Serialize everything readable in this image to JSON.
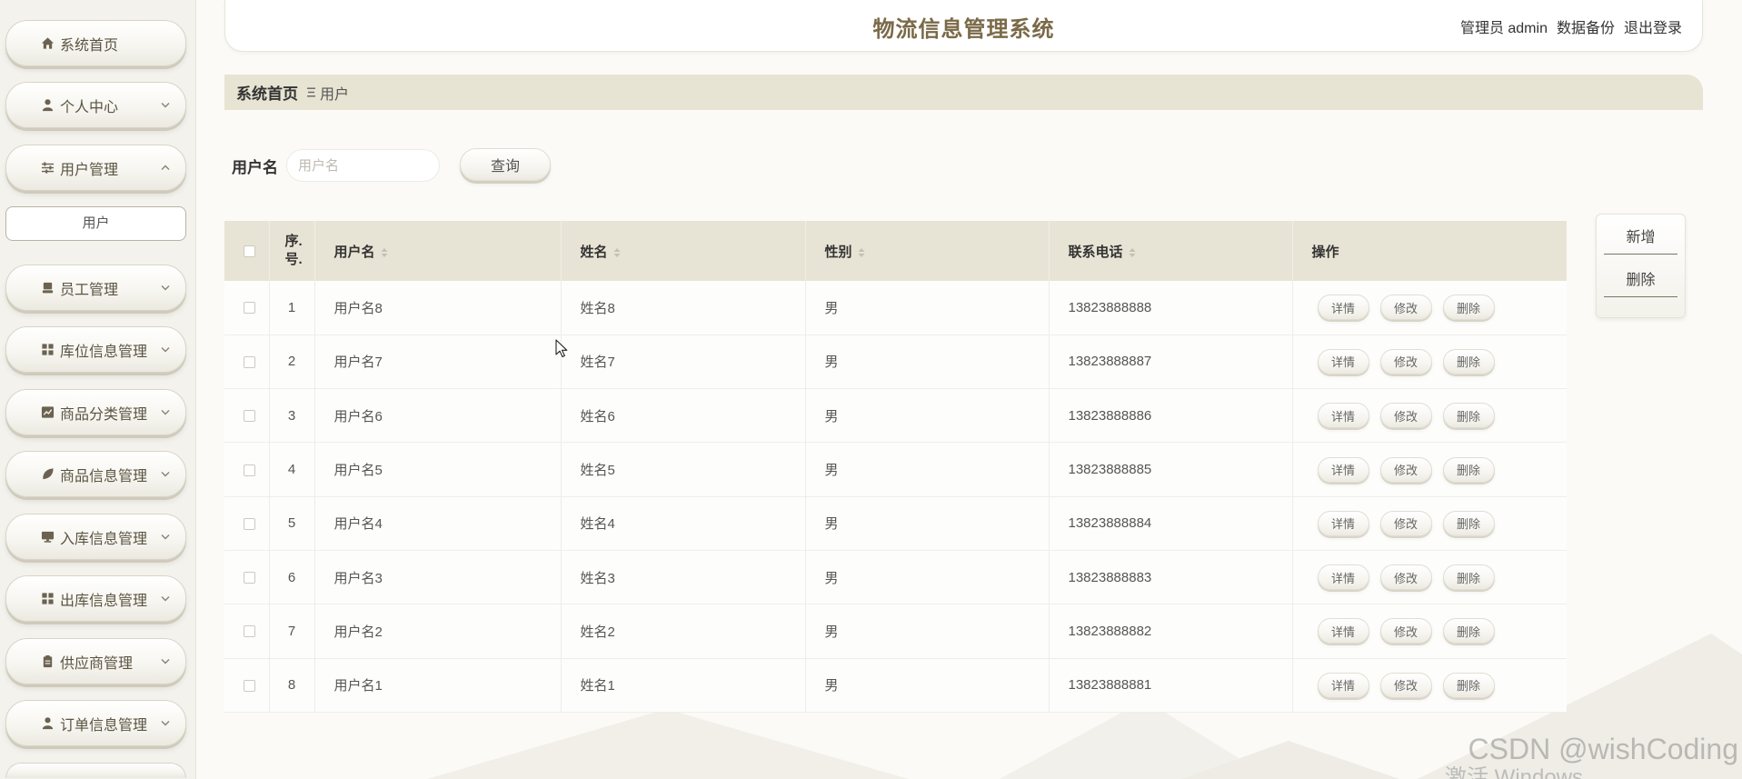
{
  "header": {
    "title": "物流信息管理系统",
    "user_label": "管理员 admin",
    "backup_label": "数据备份",
    "logout_label": "退出登录"
  },
  "sidebar": {
    "items": [
      {
        "label": "系统首页",
        "icon": "home-icon"
      },
      {
        "label": "个人中心",
        "icon": "person-icon",
        "chevron": "chevron-down-icon"
      },
      {
        "label": "用户管理",
        "icon": "sliders-icon",
        "chevron": "chevron-up-icon",
        "expanded": true
      },
      {
        "label": "员工管理",
        "icon": "archive-icon",
        "chevron": "chevron-down-icon"
      },
      {
        "label": "库位信息管理",
        "icon": "grid-icon",
        "chevron": "chevron-down-icon"
      },
      {
        "label": "商品分类管理",
        "icon": "chart-icon",
        "chevron": "chevron-down-icon"
      },
      {
        "label": "商品信息管理",
        "icon": "leaf-icon",
        "chevron": "chevron-down-icon"
      },
      {
        "label": "入库信息管理",
        "icon": "monitor-icon",
        "chevron": "chevron-down-icon"
      },
      {
        "label": "出库信息管理",
        "icon": "grid-icon",
        "chevron": "chevron-down-icon"
      },
      {
        "label": "供应商管理",
        "icon": "clipboard-icon",
        "chevron": "chevron-down-icon"
      },
      {
        "label": "订单信息管理",
        "icon": "person-icon",
        "chevron": "chevron-down-icon"
      }
    ],
    "submenu": [
      {
        "label": "用户",
        "active": true
      }
    ]
  },
  "breadcrumb": {
    "home": "系统首页",
    "separator_icon": "menu-lines-icon",
    "current": "用户"
  },
  "search": {
    "label": "用户名",
    "placeholder": "用户名",
    "value": "",
    "button_label": "查询"
  },
  "toolbar": {
    "add_label": "新增",
    "delete_label": "删除"
  },
  "table": {
    "seq_header": [
      "序.",
      "号."
    ],
    "headers": {
      "username": "用户名",
      "name": "姓名",
      "gender": "性别",
      "phone": "联系电话",
      "actions": "操作"
    },
    "row_actions": {
      "detail": "详情",
      "edit": "修改",
      "delete": "删除"
    },
    "rows": [
      {
        "seq": 1,
        "username": "用户名8",
        "name": "姓名8",
        "gender": "男",
        "phone": "13823888888"
      },
      {
        "seq": 2,
        "username": "用户名7",
        "name": "姓名7",
        "gender": "男",
        "phone": "13823888887"
      },
      {
        "seq": 3,
        "username": "用户名6",
        "name": "姓名6",
        "gender": "男",
        "phone": "13823888886"
      },
      {
        "seq": 4,
        "username": "用户名5",
        "name": "姓名5",
        "gender": "男",
        "phone": "13823888885"
      },
      {
        "seq": 5,
        "username": "用户名4",
        "name": "姓名4",
        "gender": "男",
        "phone": "13823888884"
      },
      {
        "seq": 6,
        "username": "用户名3",
        "name": "姓名3",
        "gender": "男",
        "phone": "13823888883"
      },
      {
        "seq": 7,
        "username": "用户名2",
        "name": "姓名2",
        "gender": "男",
        "phone": "13823888882"
      },
      {
        "seq": 8,
        "username": "用户名1",
        "name": "姓名1",
        "gender": "男",
        "phone": "13823888881"
      }
    ]
  },
  "watermark": {
    "csdn": "CSDN @wishCoding",
    "windows": "激活 Windows"
  },
  "colors": {
    "title": "#7a6a48",
    "sidebar_bg": "#f4f2ec",
    "breadcrumb_bg": "#e8e4d3",
    "table_header_bg": "#e8e4d5",
    "text": "#555555"
  }
}
